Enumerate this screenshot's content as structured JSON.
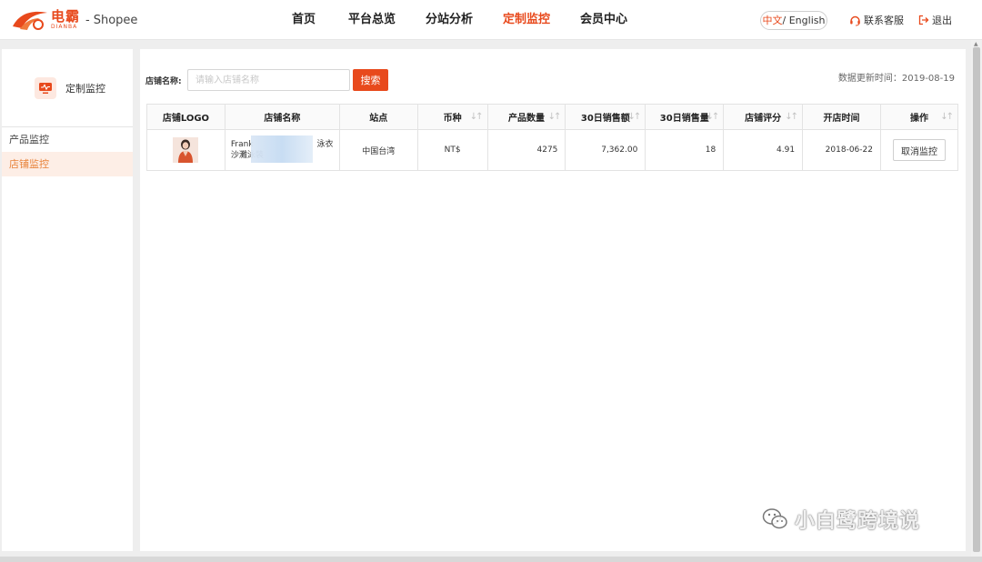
{
  "header": {
    "brand": "电霸",
    "brand_sub": "DIANBA",
    "separator": "-",
    "platform": "Shopee",
    "nav": [
      {
        "label": "首页",
        "active": false
      },
      {
        "label": "平台总览",
        "active": false
      },
      {
        "label": "分站分析",
        "active": false
      },
      {
        "label": "定制监控",
        "active": true
      },
      {
        "label": "会员中心",
        "active": false
      }
    ],
    "lang_zh": "中文",
    "lang_en": "/ English",
    "support": "联系客服",
    "logout": "退出",
    "accent_color": "#e8491c"
  },
  "sidebar": {
    "title": "定制监控",
    "items": [
      {
        "label": "产品监控",
        "active": false
      },
      {
        "label": "店铺监控",
        "active": true
      }
    ]
  },
  "main": {
    "search_label": "店铺名称:",
    "search_placeholder": "请输入店铺名称",
    "search_button": "搜索",
    "update_time": "数据更新时间：2019-08-19",
    "columns": [
      "店铺LOGO",
      "店铺名称",
      "站点",
      "币种",
      "产品数量",
      "30日销售额",
      "30日销售量",
      "店铺评分",
      "开店时间",
      "操作"
    ],
    "rows": [
      {
        "shop_name_line1": "Frank",
        "shop_name_line1_end": "泳衣",
        "shop_name_line2": "沙灘泳裝",
        "site": "中国台湾",
        "currency": "NT$",
        "product_count": "4275",
        "sales_30d": "7,362.00",
        "volume_30d": "18",
        "rating": "4.91",
        "open_date": "2018-06-22",
        "action": "取消监控"
      }
    ]
  },
  "watermark": "小白鹭跨境说"
}
